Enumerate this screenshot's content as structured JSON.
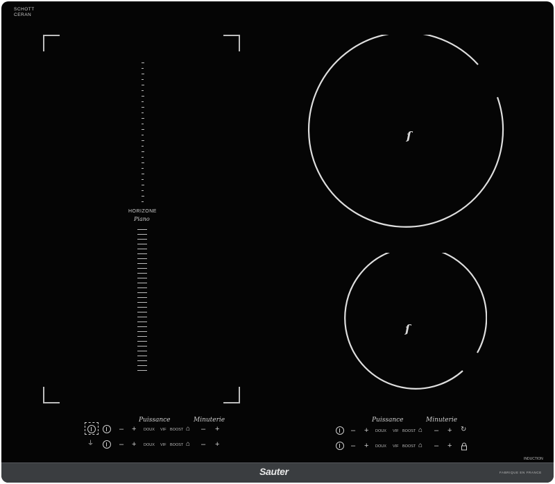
{
  "brand": {
    "schott_line1": "SCHOTT",
    "schott_line2": "CERAN",
    "horizone": "HORIZONE",
    "piano": "Piano",
    "maker": "Sauter",
    "fabrique": "FABRIQUE EN FRANCE",
    "induction": "INDUCTION"
  },
  "controls_left": {
    "puissance": "Puissance",
    "minuterie": "Minuterie",
    "row1": {
      "minus": "–",
      "plus": "+",
      "doux": "DOUX",
      "vif": "VIF",
      "boost": "BOOST",
      "timer_minus": "–",
      "timer_plus": "+"
    },
    "row2": {
      "minus": "–",
      "plus": "+",
      "doux": "DOUX",
      "vif": "VIF",
      "boost": "BOOST",
      "timer_minus": "–",
      "timer_plus": "+"
    }
  },
  "controls_right": {
    "puissance": "Puissance",
    "minuterie": "Minuterie",
    "row1": {
      "minus": "–",
      "plus": "+",
      "doux": "DOUX",
      "vif": "VIF",
      "boost": "BOOST",
      "timer_minus": "–",
      "timer_plus": "+"
    },
    "row2": {
      "minus": "–",
      "plus": "+",
      "doux": "DOUX",
      "vif": "VIF",
      "boost": "BOOST",
      "timer_minus": "–",
      "timer_plus": "+"
    }
  },
  "icons": [
    "power-icon",
    "zone-select-icon",
    "pot-icon",
    "keep-warm-icon",
    "pause-icon",
    "lock-icon",
    "flame-icon"
  ],
  "colors": {
    "glass": "#050505",
    "trim": "#3a3d40",
    "print": "#cfcfcf"
  }
}
